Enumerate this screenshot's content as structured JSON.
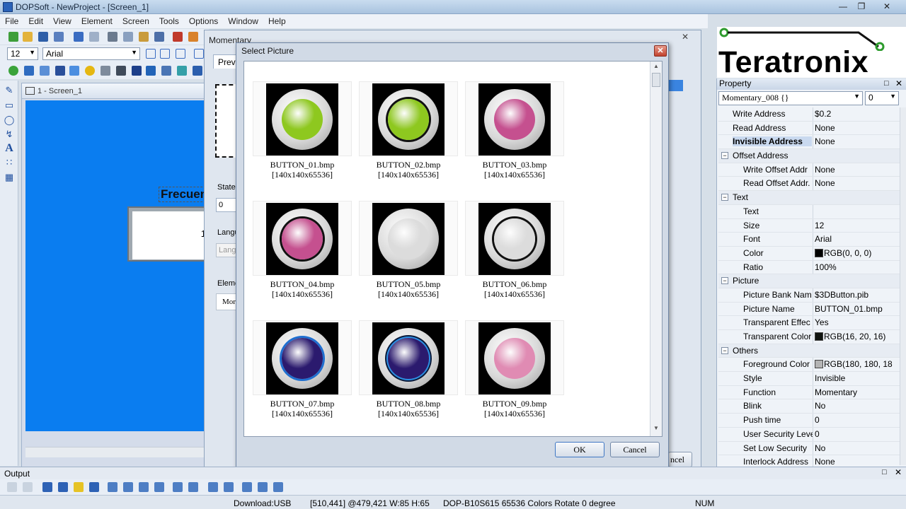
{
  "window": {
    "title": "DOPSoft - NewProject - [Screen_1]"
  },
  "menubar": {
    "items": [
      "File",
      "Edit",
      "View",
      "Element",
      "Screen",
      "Tools",
      "Options",
      "Window",
      "Help"
    ]
  },
  "fontbar": {
    "size": "12",
    "font": "Arial"
  },
  "screen_window": {
    "title": "1 - Screen_1",
    "label_text": "Frecuen",
    "numeric_value": "1"
  },
  "momentary_dialog": {
    "title": "Momentary",
    "preview_tab": "Previ",
    "state_label": "State:",
    "state_value": "0",
    "language_label": "Langu",
    "language_value": "Langu",
    "element_label": "Eleme",
    "element_value": "Mor",
    "cancel_fragment": "ncel"
  },
  "select_picture": {
    "title": "Select Picture",
    "ok_label": "OK",
    "cancel_label": "Cancel",
    "pictures": [
      {
        "name": "BUTTON_01.bmp",
        "size": "[140x140x65536]",
        "face_color": "#8ec81f",
        "style": "plain"
      },
      {
        "name": "BUTTON_02.bmp",
        "size": "[140x140x65536]",
        "face_color": "#8ec81f",
        "style": "dark-rim"
      },
      {
        "name": "BUTTON_03.bmp",
        "size": "[140x140x65536]",
        "face_color": "#c5508f",
        "style": "plain"
      },
      {
        "name": "BUTTON_04.bmp",
        "size": "[140x140x65536]",
        "face_color": "#c5508f",
        "style": "dark-rim"
      },
      {
        "name": "BUTTON_05.bmp",
        "size": "[140x140x65536]",
        "face_color": "#dcdcdc",
        "style": "plain"
      },
      {
        "name": "BUTTON_06.bmp",
        "size": "[140x140x65536]",
        "face_color": "#dcdcdc",
        "style": "dark-rim"
      },
      {
        "name": "BUTTON_07.bmp",
        "size": "[140x140x65536]",
        "face_color": "#2b1a6e",
        "style": "blue-rim"
      },
      {
        "name": "BUTTON_08.bmp",
        "size": "[140x140x65536]",
        "face_color": "#2b1a6e",
        "style": "blue-rim-dark"
      },
      {
        "name": "BUTTON_09.bmp",
        "size": "[140x140x65536]",
        "face_color": "#e08bb3",
        "style": "plain"
      }
    ]
  },
  "logo": {
    "text": "Teratronix"
  },
  "property": {
    "header": "Property",
    "element_select": "Momentary_008 {}",
    "index_value": "0",
    "rows": [
      {
        "key": "Write Address",
        "value": "$0.2",
        "kind": "item"
      },
      {
        "key": "Read Address",
        "value": "None",
        "kind": "item"
      },
      {
        "key": "Invisible Address",
        "value": "None",
        "kind": "highlight"
      },
      {
        "key": "Offset Address",
        "value": "",
        "kind": "category"
      },
      {
        "key": "Write Offset Addr",
        "value": "None",
        "kind": "sub"
      },
      {
        "key": "Read Offset Addr.",
        "value": "None",
        "kind": "sub"
      },
      {
        "key": "Text",
        "value": "",
        "kind": "category"
      },
      {
        "key": "Text",
        "value": "",
        "kind": "sub"
      },
      {
        "key": "Size",
        "value": "12",
        "kind": "sub"
      },
      {
        "key": "Font",
        "value": "Arial",
        "kind": "sub"
      },
      {
        "key": "Color",
        "value": "RGB(0, 0, 0)",
        "kind": "sub",
        "swatch": "#000000"
      },
      {
        "key": "Ratio",
        "value": "100%",
        "kind": "sub"
      },
      {
        "key": "Picture",
        "value": "",
        "kind": "category"
      },
      {
        "key": "Picture Bank Nam",
        "value": "$3DButton.pib",
        "kind": "sub"
      },
      {
        "key": "Picture Name",
        "value": "BUTTON_01.bmp",
        "kind": "sub"
      },
      {
        "key": "Transparent Effec",
        "value": "Yes",
        "kind": "sub"
      },
      {
        "key": "Transparent Color",
        "value": "RGB(16, 20, 16)",
        "kind": "sub",
        "swatch": "#101410"
      },
      {
        "key": "Others",
        "value": "",
        "kind": "category"
      },
      {
        "key": "Foreground Color",
        "value": "RGB(180, 180, 18",
        "kind": "sub",
        "swatch": "#b4b4b4"
      },
      {
        "key": "Style",
        "value": "Invisible",
        "kind": "sub"
      },
      {
        "key": "Function",
        "value": "Momentary",
        "kind": "sub"
      },
      {
        "key": "Blink",
        "value": "No",
        "kind": "sub"
      },
      {
        "key": "Push time",
        "value": "0",
        "kind": "sub"
      },
      {
        "key": "User Security Leve",
        "value": "0",
        "kind": "sub"
      },
      {
        "key": "Set Low Security",
        "value": "No",
        "kind": "sub"
      },
      {
        "key": "Interlock Address",
        "value": "None",
        "kind": "sub"
      }
    ]
  },
  "output": {
    "label": "Output"
  },
  "statusbar": {
    "download": "Download:USB",
    "coords": "[510,441] @479,421 W:85 H:65",
    "device": "DOP-B10S615 65536 Colors Rotate 0 degree",
    "num": "NUM"
  }
}
